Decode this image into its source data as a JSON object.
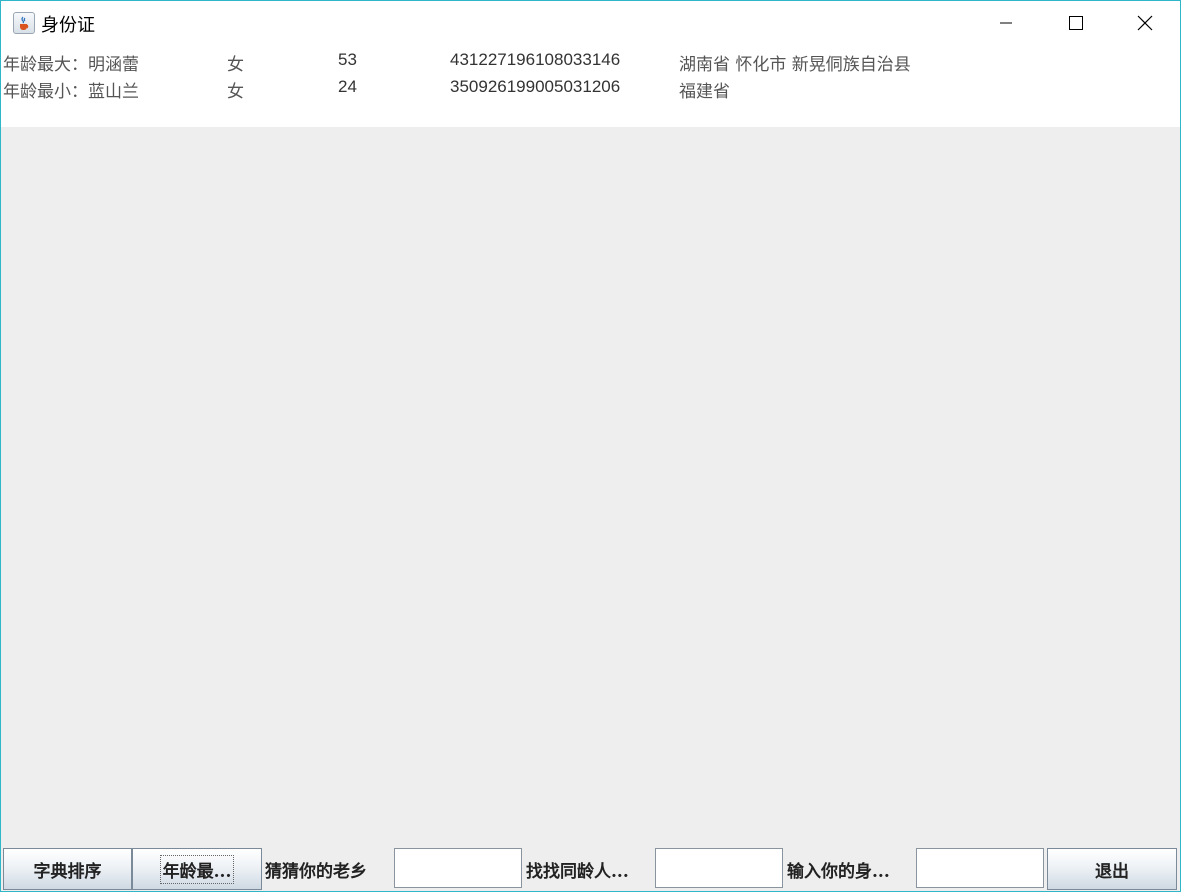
{
  "window": {
    "title": "身份证",
    "icon": "java-cup-icon",
    "border_color": "#2fb6c9"
  },
  "results": [
    {
      "name": "年龄最大：明涵蕾",
      "gender": "女",
      "age": "53",
      "id": "431227196108033146",
      "address": "湖南省 怀化市 新晃侗族自治县"
    },
    {
      "name": "年龄最小：蓝山兰",
      "gender": "女",
      "age": "24",
      "id": "350926199005031206",
      "address": "福建省"
    }
  ],
  "toolbar": {
    "sort_label": "字典排序",
    "age_extreme_label": "年龄最...",
    "hometown_label": "猜猜你的老乡",
    "hometown_value": "",
    "same_age_label": "找找同龄人...",
    "same_age_value": "",
    "input_id_label": "输入你的身...",
    "input_id_value": "",
    "exit_label": "退出"
  }
}
